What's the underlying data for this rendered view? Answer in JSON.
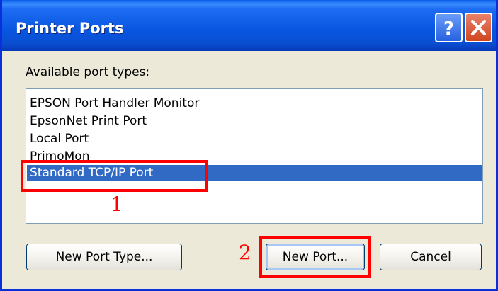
{
  "window": {
    "title": "Printer Ports"
  },
  "titlebar": {
    "help_icon": "question-mark-icon",
    "close_icon": "close-x-icon",
    "help_glyph": "?",
    "close_glyph": "✕"
  },
  "dialog": {
    "label": "Available port types:",
    "port_types": [
      "EPSON Port Handler Monitor",
      "EpsonNet Print Port",
      "Local Port",
      "PrimoMon",
      "Standard TCP/IP Port"
    ],
    "selected_index": 4
  },
  "buttons": {
    "new_port_type": "New Port Type...",
    "new_port": "New Port...",
    "cancel": "Cancel"
  },
  "annotations": {
    "step1": "1",
    "step2": "2",
    "color": "#ff0000"
  },
  "colors": {
    "titlebar": "#0856e0",
    "selection": "#316ac5",
    "dialog_bg": "#ece9d8"
  }
}
